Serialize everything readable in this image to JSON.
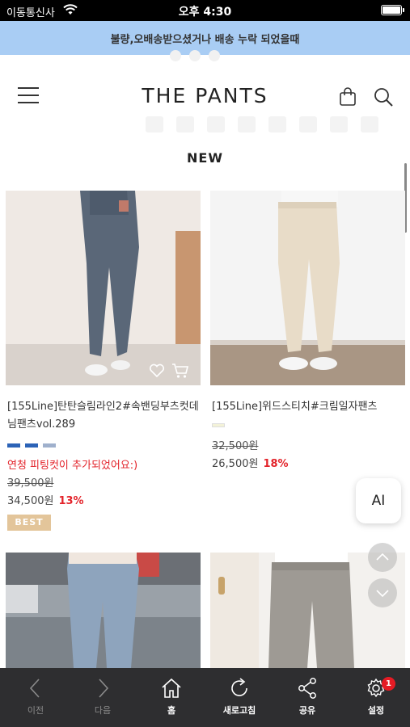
{
  "status_bar": {
    "carrier": "이동통신사",
    "time": "오후 4:30"
  },
  "notice": "불량,오배송받으셨거나 배송 누락 되었을때",
  "header": {
    "logo": "THE PANTS"
  },
  "section_title": "NEW",
  "products": [
    {
      "name": "[155Line]탄탄슬림라인2#속밴딩부츠컷데님팬츠vol.289",
      "swatch_colors": [
        "#2c63b7",
        "#2c63b7",
        "#9fb0cc"
      ],
      "promo": "연청 피팅컷이 추가되었어요:)",
      "price_original": "39,500원",
      "price_sale": "34,500원",
      "discount": "13%",
      "badge": "BEST"
    },
    {
      "name": "[155Line]위드스티치#크림일자팬츠",
      "swatch_colors": [
        "#f3f2d8"
      ],
      "price_original": "32,500원",
      "price_sale": "26,500원",
      "discount": "18%"
    }
  ],
  "ai_button": "AI",
  "bottom_nav": [
    {
      "label": "이전",
      "icon": "chevron-left-icon"
    },
    {
      "label": "다음",
      "icon": "chevron-right-icon"
    },
    {
      "label": "홈",
      "icon": "home-icon"
    },
    {
      "label": "새로고침",
      "icon": "refresh-icon"
    },
    {
      "label": "공유",
      "icon": "share-icon"
    },
    {
      "label": "설정",
      "icon": "gear-icon",
      "badge": "1"
    }
  ],
  "colors": {
    "notice_bg": "#a9cdf4",
    "accent_red": "#e3232a",
    "bottom_bar": "#2e2e30",
    "best_badge": "#e3c59a"
  }
}
